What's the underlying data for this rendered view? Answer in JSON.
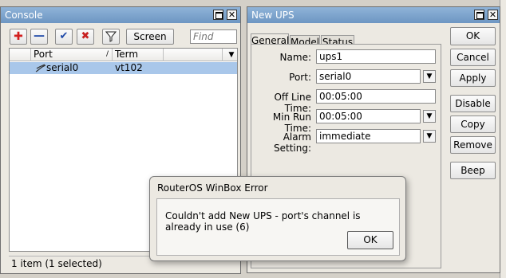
{
  "console": {
    "title": "Console",
    "toolbar": {
      "add_glyph": "✚",
      "remove_glyph": "—",
      "enable_glyph": "✔",
      "disable_glyph": "✖",
      "screen_label": "Screen",
      "find_placeholder": "Find"
    },
    "columns": [
      "Port",
      "Term"
    ],
    "rows": [
      {
        "port": "serial0",
        "term": "vt102",
        "selected": true
      }
    ],
    "status": "1 item (1 selected)"
  },
  "new_ups": {
    "title": "New UPS",
    "tabs": [
      "General",
      "Model",
      "Status"
    ],
    "active_tab": "General",
    "fields": {
      "name": {
        "label": "Name:",
        "value": "ups1"
      },
      "port": {
        "label": "Port:",
        "value": "serial0"
      },
      "off_line_time": {
        "label": "Off Line Time:",
        "value": "00:05:00"
      },
      "min_run_time": {
        "label": "Min Run Time:",
        "value": "00:05:00"
      },
      "alarm_setting": {
        "label": "Alarm Setting:",
        "value": "immediate"
      }
    },
    "buttons": {
      "ok": "OK",
      "cancel": "Cancel",
      "apply": "Apply",
      "disable": "Disable",
      "copy": "Copy",
      "remove": "Remove",
      "beep": "Beep"
    }
  },
  "error_dialog": {
    "title": "RouterOS WinBox Error",
    "message": "Couldn't add New UPS - port's channel is already in use (6)",
    "ok": "OK"
  },
  "colors": {
    "titlebar": "#7ba3cf",
    "selected_row": "#a9c7ea",
    "add_icon": "#d32020",
    "remove_icon": "#1f49a8",
    "check_icon": "#1f49a8",
    "x_icon": "#c82020"
  }
}
